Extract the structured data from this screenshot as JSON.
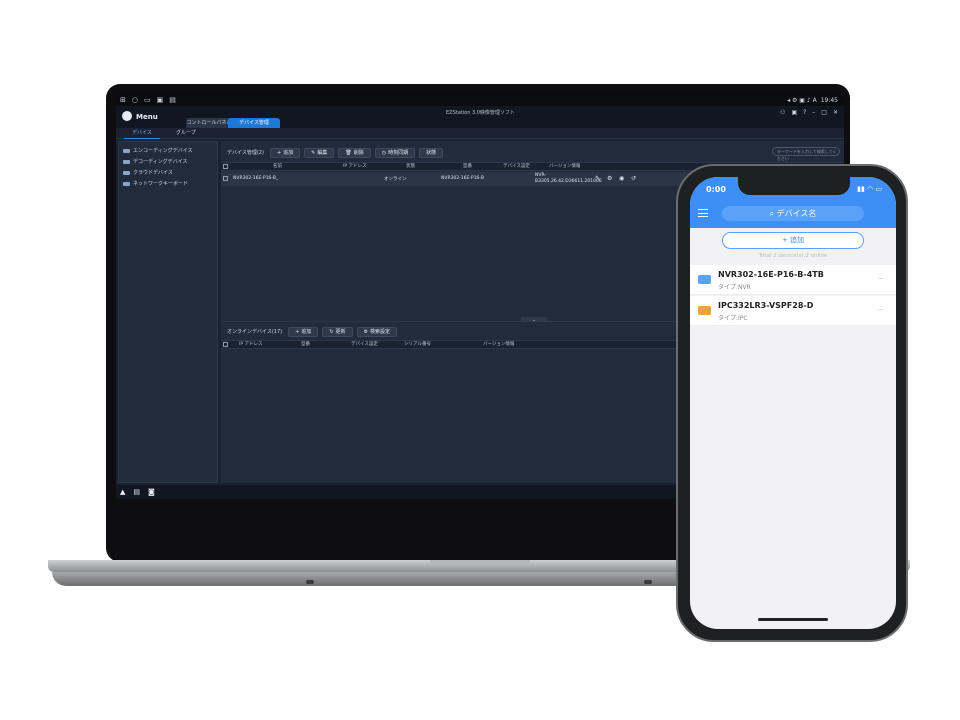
{
  "laptop": {
    "taskbar": {
      "time": "19:45"
    },
    "menu_label": "Menu",
    "app_title": "EZStation 3.0映像管理ソフト",
    "tabs": [
      {
        "label": "コントロールパネル"
      },
      {
        "label": "デバイス管理"
      }
    ],
    "subtabs": [
      {
        "label": "デバイス"
      },
      {
        "label": "グループ"
      }
    ],
    "sidebar": [
      {
        "label": "エンコーディングデバイス"
      },
      {
        "label": "デコーディングデバイス"
      },
      {
        "label": "クラウドデバイス"
      },
      {
        "label": "ネットワークキーボード"
      }
    ],
    "device_panel": {
      "title": "デバイス管理(2)",
      "buttons": [
        {
          "label": "追加",
          "icon": "+"
        },
        {
          "label": "編集",
          "icon": "✎"
        },
        {
          "label": "削除",
          "icon": "🗑"
        },
        {
          "label": "時刻同期",
          "icon": "◷"
        },
        {
          "label": "状態",
          "icon": ""
        }
      ],
      "search_placeholder": "キーワードを入力して検索してください",
      "columns": [
        "名前",
        "IP アドレス",
        "状態",
        "型番",
        "デバイス設定",
        "バージョン情報"
      ],
      "rows": [
        {
          "name": "NVR302-16E-P16-B_",
          "ip": "",
          "status": "オンライン",
          "model": "NVR302-16E-P16-B",
          "config": "",
          "version_line1": "NVR-",
          "version_line2": "B3305.26.42.D36611.201006"
        }
      ]
    },
    "online_panel": {
      "title": "オンラインデバイス(17)",
      "buttons": [
        {
          "label": "追加",
          "icon": "+"
        },
        {
          "label": "更新",
          "icon": "↻"
        },
        {
          "label": "検索設定",
          "icon": "⚙"
        }
      ],
      "columns": [
        "IP アドレス",
        "型番",
        "デバイス設定",
        "シリアル番号",
        "バージョン情報"
      ]
    }
  },
  "phone": {
    "time": "0:00",
    "search_label": "デバイス名",
    "add_label": "+ 追加",
    "total_text": "Total 2 device(s),2 online",
    "devices": [
      {
        "name": "NVR302-16E-P16-B-4TB",
        "type": "タイプ:NVR",
        "icon_color": "#5aa2f7"
      },
      {
        "name": "IPC332LR3-VSPF28-D",
        "type": "タイプ:IPC",
        "icon_color": "#f3a23b"
      }
    ]
  }
}
